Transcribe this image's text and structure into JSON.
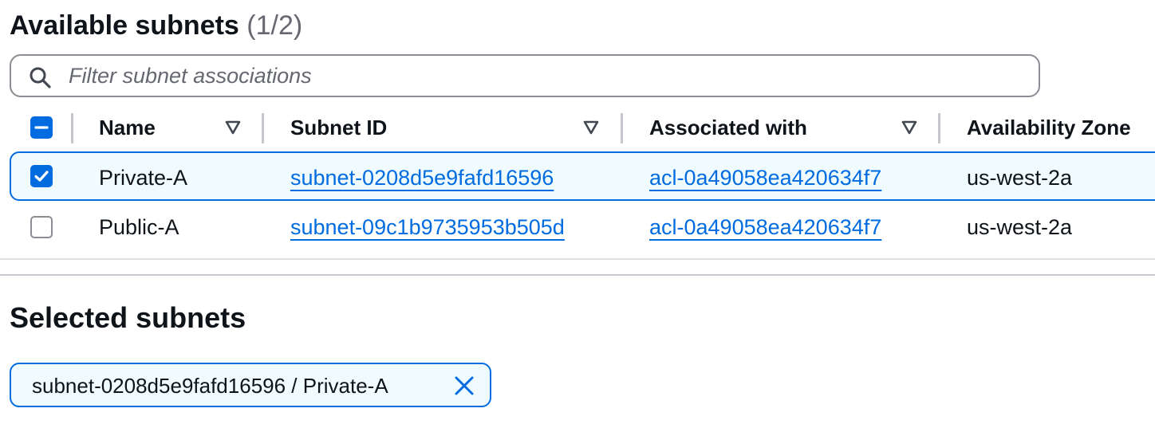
{
  "header": {
    "title": "Available subnets",
    "count": "(1/2)"
  },
  "filter": {
    "placeholder": "Filter subnet associations",
    "value": ""
  },
  "table": {
    "columns": [
      "Name",
      "Subnet ID",
      "Associated with",
      "Availability Zone"
    ],
    "rows": [
      {
        "name": "Private-A",
        "subnet_id": "subnet-0208d5e9fafd16596",
        "associated_with": "acl-0a49058ea420634f7",
        "az": "us-west-2a",
        "selected": true
      },
      {
        "name": "Public-A",
        "subnet_id": "subnet-09c1b9735953b505d",
        "associated_with": "acl-0a49058ea420634f7",
        "az": "us-west-2a",
        "selected": false
      }
    ]
  },
  "selected": {
    "title": "Selected subnets",
    "tokens": [
      "subnet-0208d5e9fafd16596 / Private-A"
    ]
  },
  "icons": {
    "search": "search-icon",
    "sort": "caret-down-outline-icon",
    "checkbox_indeterminate": "minus-icon",
    "checkbox_checked": "check-icon",
    "dismiss": "close-icon"
  },
  "colors": {
    "accent": "#006ce0",
    "selected_bg": "#f0fbff",
    "text": "#0f141a",
    "muted": "#656871"
  }
}
